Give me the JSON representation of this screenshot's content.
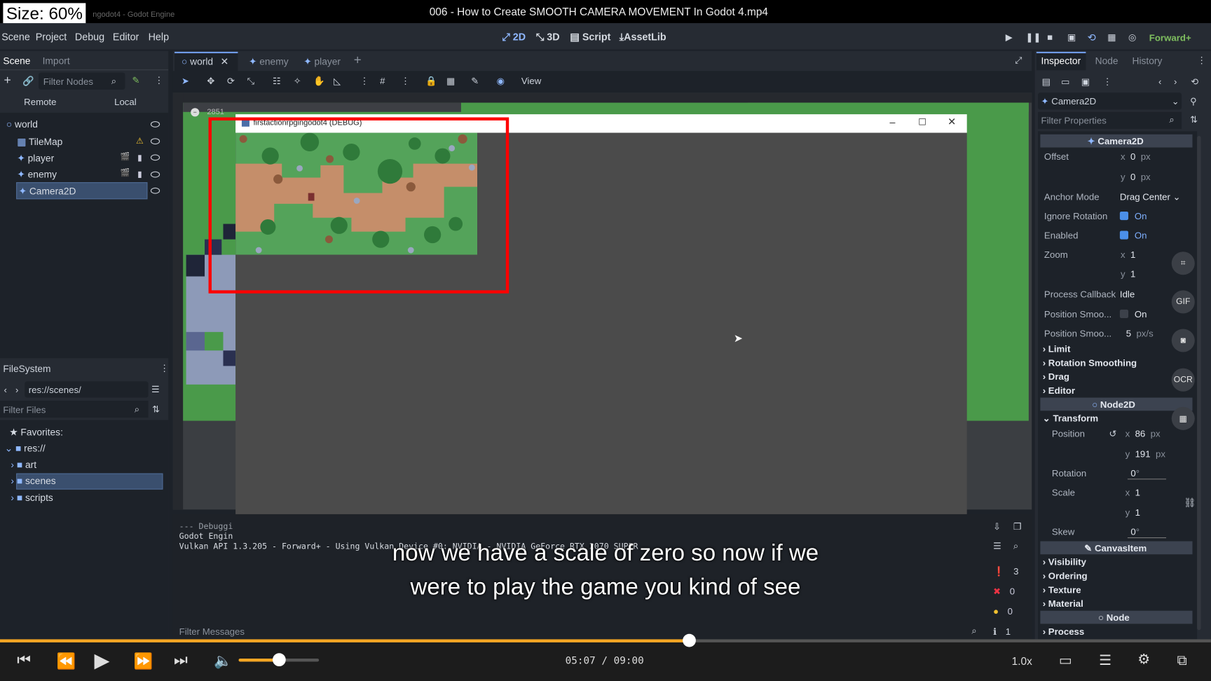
{
  "video": {
    "title": "006 - How to Create SMOOTH CAMERA MOVEMENT In Godot 4.mp4",
    "size_badge": "Size: 60%",
    "app_title": "ngodot4 - Godot Engine",
    "subtitle_line1": "now we have a scale of zero so now if we",
    "subtitle_line2": "were to play the game you kind of see",
    "time": "05:07 / 09:00",
    "speed": "1.0x",
    "progress": 0.569,
    "volume": 0.5
  },
  "menu": [
    "Scene",
    "Project",
    "Debug",
    "Editor",
    "Help"
  ],
  "workspaces": [
    "2D",
    "3D",
    "Script",
    "AssetLib"
  ],
  "renderer": "Forward+",
  "scene_dock": {
    "tabs": [
      "Scene",
      "Import"
    ],
    "filter_placeholder": "Filter Nodes",
    "remote": "Remote",
    "local": "Local",
    "nodes": [
      "world",
      "TileMap",
      "player",
      "enemy",
      "Camera2D"
    ]
  },
  "filesystem": {
    "title": "FileSystem",
    "path": "res://scenes/",
    "filter_placeholder": "Filter Files",
    "favorites": "Favorites:",
    "root": "res://",
    "folders": [
      "art",
      "scenes",
      "scripts"
    ]
  },
  "editor_tabs": [
    "world",
    "enemy",
    "player"
  ],
  "toolbar": {
    "view": "View"
  },
  "ruler_label": "2851",
  "game_window": {
    "title": "firstactionrpgingodot4 (DEBUG)"
  },
  "output": {
    "lines": [
      "--- Debuggi",
      "Godot Engin",
      "Vulkan API 1.3.205 - Forward+ - Using Vulkan Device #0: NVIDIA - NVIDIA GeForce RTX 2070 SUPER"
    ],
    "filter_placeholder": "Filter Messages",
    "counts": [
      "3",
      "0",
      "0",
      "1"
    ]
  },
  "inspector": {
    "tabs": [
      "Inspector",
      "Node",
      "History"
    ],
    "node_type": "Camera2D",
    "filter_placeholder": "Filter Properties",
    "header": "Camera2D",
    "offset_label": "Offset",
    "offset_x": "0",
    "offset_y": "0",
    "unit_px": "px",
    "anchor_label": "Anchor Mode",
    "anchor_value": "Drag Center",
    "ignore_rotation_label": "Ignore Rotation",
    "enabled_label": "Enabled",
    "on": "On",
    "zoom_label": "Zoom",
    "zoom_x": "1",
    "zoom_y": "1",
    "process_callback_label": "Process Callback",
    "process_callback_value": "Idle",
    "pos_smooth_label": "Position Smoo...",
    "pos_smooth_speed_label": "Position Smoo...",
    "pos_smooth_speed": "5",
    "pos_smooth_unit": "px/s",
    "sections1": [
      "Limit",
      "Rotation Smoothing",
      "Drag",
      "Editor"
    ],
    "node2d_header": "Node2D",
    "transform": "Transform",
    "position_label": "Position",
    "pos_x": "86",
    "pos_y": "191",
    "rotation_label": "Rotation",
    "rotation_value": "0",
    "scale_label": "Scale",
    "scale_x": "1",
    "scale_y": "1",
    "skew_label": "Skew",
    "skew_value": "0",
    "canvasitem_header": "CanvasItem",
    "sections2": [
      "Visibility",
      "Ordering",
      "Texture",
      "Material"
    ],
    "node_header": "Node",
    "process": "Process",
    "axis_x": "x",
    "axis_y": "y"
  },
  "overlay_buttons": [
    "GIF",
    "OCR"
  ],
  "colors": {
    "accent": "#f5a623",
    "highlight": "#ff0000",
    "selection": "#3a4f6e",
    "grass": "#4a9a4a"
  }
}
